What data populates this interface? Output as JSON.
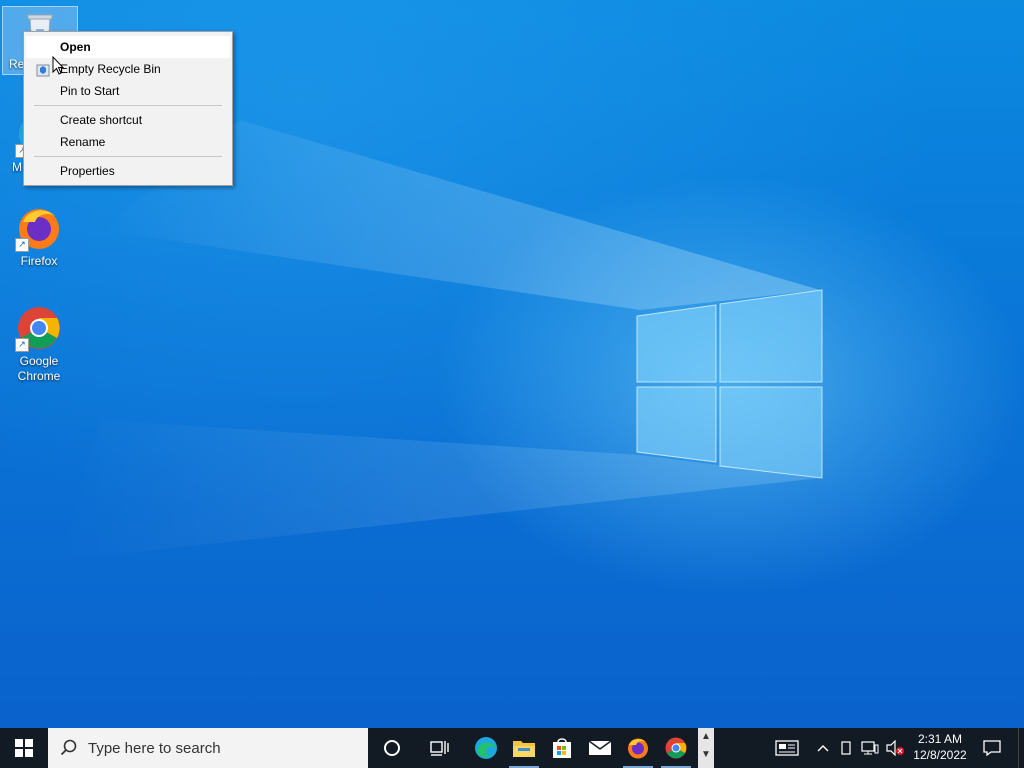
{
  "desktop": {
    "icons": [
      {
        "label": "Re",
        "name": "recycle-bin",
        "selected": true
      },
      {
        "label": "M",
        "name": "microsoft-edge"
      },
      {
        "label": "Firefox",
        "name": "firefox"
      },
      {
        "label": "Google\nChrome",
        "name": "google-chrome"
      }
    ]
  },
  "context_menu": {
    "items": [
      {
        "label": "Open",
        "default": true
      },
      {
        "label": "Empty Recycle Bin",
        "icon": "shield-icon"
      },
      {
        "label": "Pin to Start"
      },
      {
        "separator": true
      },
      {
        "label": "Create shortcut"
      },
      {
        "label": "Rename"
      },
      {
        "separator": true
      },
      {
        "label": "Properties"
      }
    ]
  },
  "taskbar": {
    "search_placeholder": "Type here to search",
    "pinned": [
      "cortana-icon",
      "task-view-icon",
      "edge-icon",
      "file-explorer-icon",
      "store-icon",
      "mail-icon",
      "firefox-icon",
      "chrome-icon"
    ],
    "clock": {
      "time": "2:31 AM",
      "date": "12/8/2022"
    }
  },
  "colors": {
    "desktop_blue": "#0a78d8",
    "taskbar_bg": "#121a24",
    "menu_bg": "#f2f2f2"
  }
}
